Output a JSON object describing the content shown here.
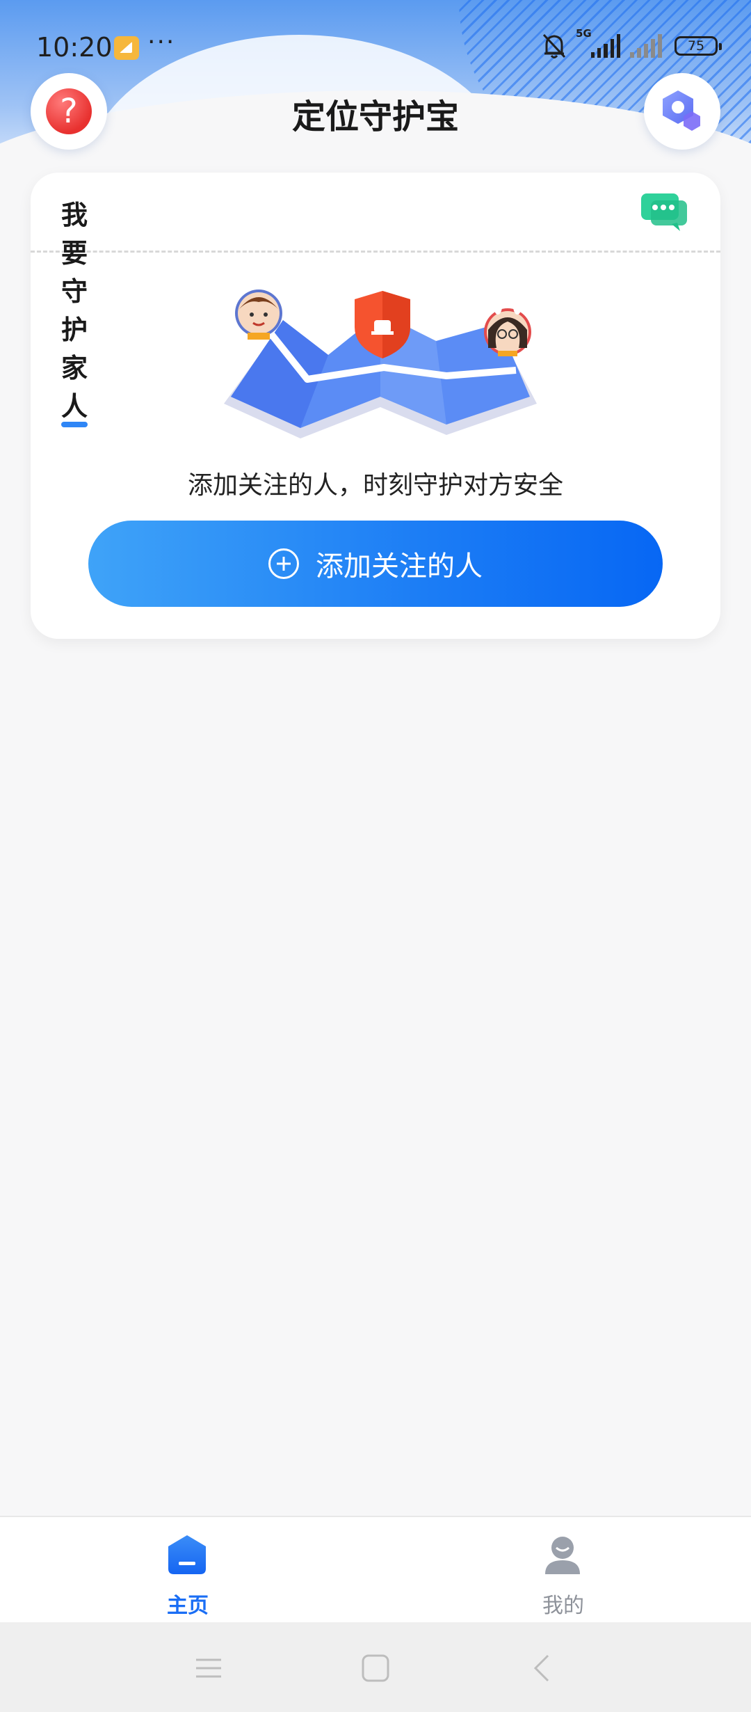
{
  "status_bar": {
    "time": "10:20",
    "more": "···",
    "network_tag": "5G",
    "battery": "75",
    "icons": [
      "app-notification-icon",
      "bell-off-icon",
      "signal-5g-icon",
      "signal-weak-icon",
      "battery-icon"
    ]
  },
  "header": {
    "title": "定位守护宝",
    "help_icon": "question-icon",
    "help_glyph": "?",
    "settings_icon": "hexagon-settings-icon"
  },
  "card": {
    "title": "我要守护家人",
    "message_icon": "chat-bubble-icon",
    "illustration": "map-with-shield-and-family-illustration",
    "tip": "添加关注的人，时刻守护对方安全",
    "add_button_label": "添加关注的人",
    "add_icon": "plus-circle-icon"
  },
  "tab_bar": {
    "tabs": [
      {
        "label": "主页",
        "icon": "home-icon",
        "active": true
      },
      {
        "label": "我的",
        "icon": "user-icon",
        "active": false
      }
    ]
  },
  "system_nav": {
    "buttons": [
      "menu-icon",
      "home-square-icon",
      "back-icon"
    ]
  },
  "colors": {
    "accent": "#1a6ef5",
    "help": "#e8312f",
    "chat": "#2fd19a"
  }
}
